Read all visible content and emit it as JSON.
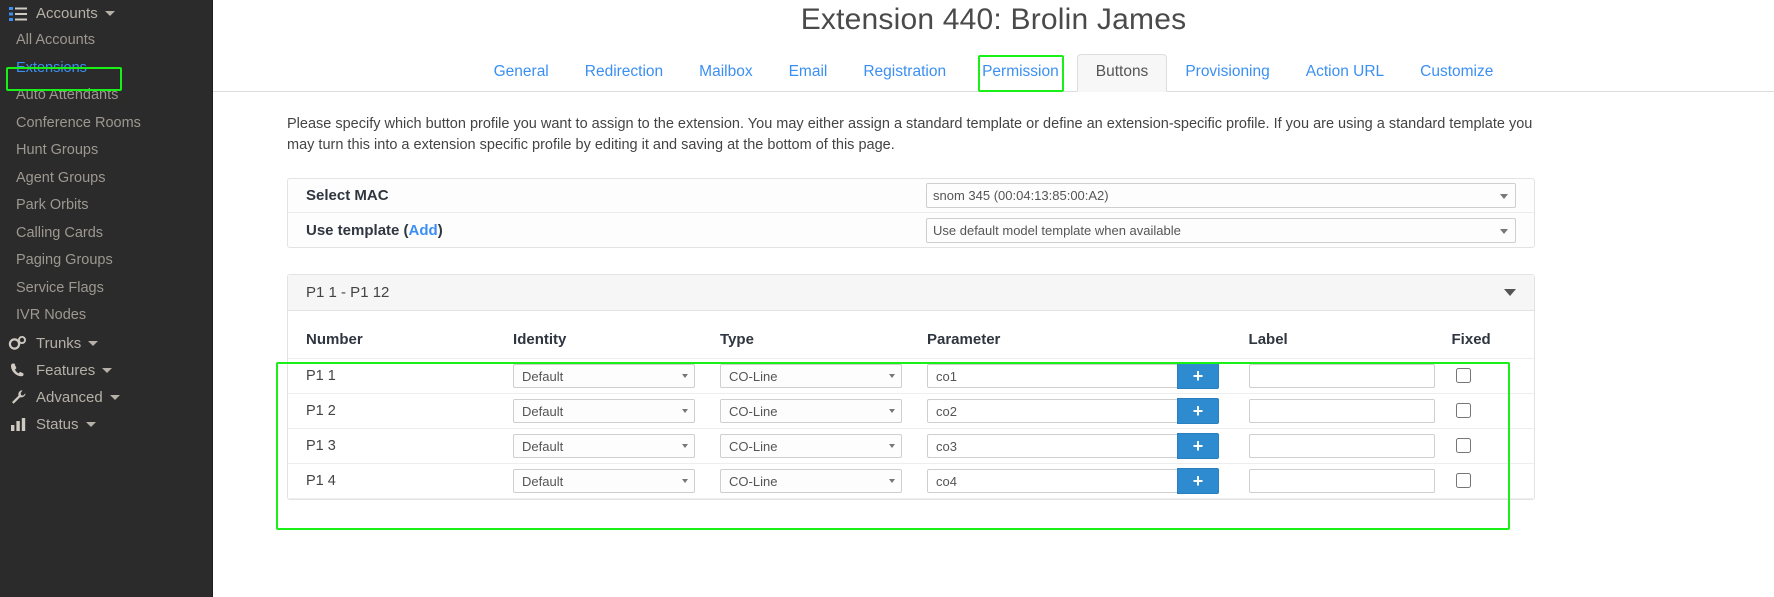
{
  "sidebar": {
    "groups": [
      {
        "label": "Accounts",
        "icon": "list-icon",
        "items": [
          {
            "label": "All Accounts",
            "active": false
          },
          {
            "label": "Extensions",
            "active": true
          },
          {
            "label": "Auto Attendants",
            "active": false
          },
          {
            "label": "Conference Rooms",
            "active": false
          },
          {
            "label": "Hunt Groups",
            "active": false
          },
          {
            "label": "Agent Groups",
            "active": false
          },
          {
            "label": "Park Orbits",
            "active": false
          },
          {
            "label": "Calling Cards",
            "active": false
          },
          {
            "label": "Paging Groups",
            "active": false
          },
          {
            "label": "Service Flags",
            "active": false
          },
          {
            "label": "IVR Nodes",
            "active": false
          }
        ]
      },
      {
        "label": "Trunks",
        "icon": "gears-icon",
        "items": []
      },
      {
        "label": "Features",
        "icon": "phone-icon",
        "items": []
      },
      {
        "label": "Advanced",
        "icon": "wrench-icon",
        "items": []
      },
      {
        "label": "Status",
        "icon": "bar-chart-icon",
        "items": []
      }
    ]
  },
  "header": {
    "title": "Extension 440: Brolin James"
  },
  "tabs": [
    {
      "label": "General",
      "active": false
    },
    {
      "label": "Redirection",
      "active": false
    },
    {
      "label": "Mailbox",
      "active": false
    },
    {
      "label": "Email",
      "active": false
    },
    {
      "label": "Registration",
      "active": false
    },
    {
      "label": "Permission",
      "active": false
    },
    {
      "label": "Buttons",
      "active": true
    },
    {
      "label": "Provisioning",
      "active": false
    },
    {
      "label": "Action URL",
      "active": false
    },
    {
      "label": "Customize",
      "active": false
    }
  ],
  "intro": "Please specify which button profile you want to assign to the extension. You may either assign a standard template or define an extension-specific profile. If you are using a standard template you may turn this into a extension specific profile by editing it and saving at the bottom of this page.",
  "form": {
    "mac": {
      "label": "Select MAC",
      "value": "snom 345 (00:04:13:85:00:A2)"
    },
    "template": {
      "label_prefix": "Use template (",
      "label_link": "Add",
      "label_suffix": ")",
      "value": "Use default model template when available"
    }
  },
  "buttons_section": {
    "title": "P1 1 - P1 12",
    "columns": [
      "Number",
      "Identity",
      "Type",
      "Parameter",
      "Label",
      "Fixed"
    ],
    "add_button_glyph": "+",
    "rows": [
      {
        "number": "P1 1",
        "identity": "Default",
        "type": "CO-Line",
        "parameter": "co1",
        "label": "",
        "fixed": false
      },
      {
        "number": "P1 2",
        "identity": "Default",
        "type": "CO-Line",
        "parameter": "co2",
        "label": "",
        "fixed": false
      },
      {
        "number": "P1 3",
        "identity": "Default",
        "type": "CO-Line",
        "parameter": "co3",
        "label": "",
        "fixed": false
      },
      {
        "number": "P1 4",
        "identity": "Default",
        "type": "CO-Line",
        "parameter": "co4",
        "label": "",
        "fixed": false
      }
    ]
  },
  "colors": {
    "highlight": "#18f018",
    "link": "#3b8ff3",
    "accent_button": "#2e8bd0",
    "sidebar_bg": "#2b2b2b"
  }
}
